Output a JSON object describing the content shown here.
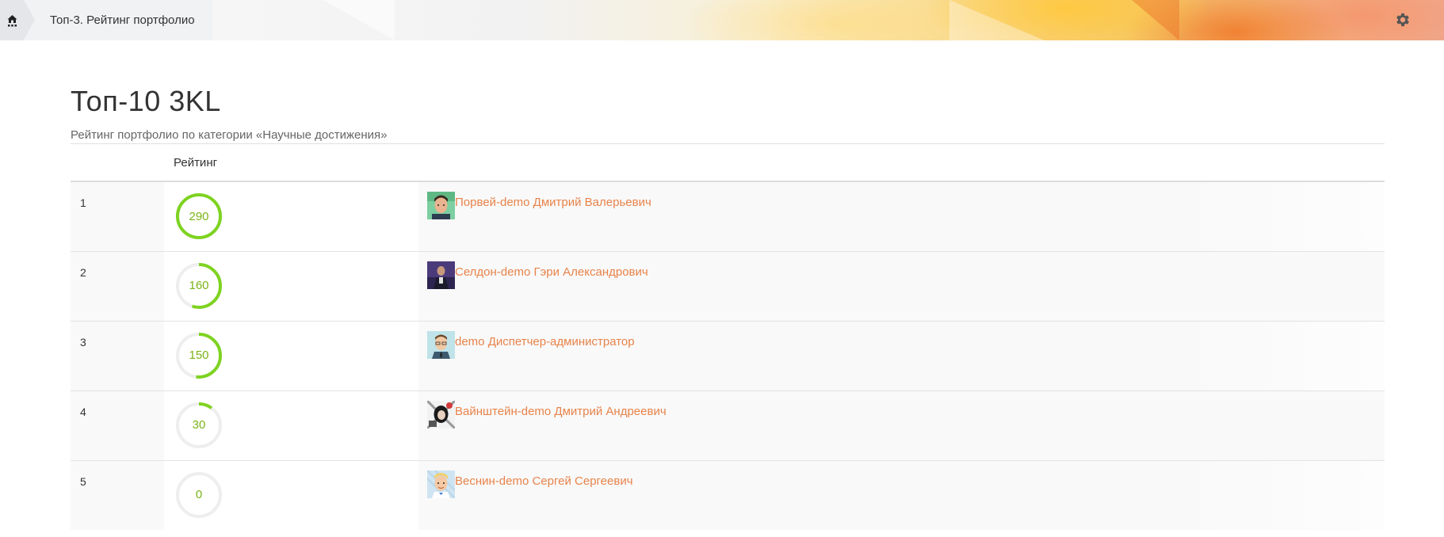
{
  "breadcrumb": {
    "current": "Топ-3. Рейтинг портфолио"
  },
  "page": {
    "title": "Топ-10 3KL",
    "subtitle": "Рейтинг портфолио по категории «Научные достижения»"
  },
  "table": {
    "headers": [
      "",
      "Рейтинг",
      ""
    ],
    "rows": [
      {
        "rank": "1",
        "score": "290",
        "score_fraction": 1.0,
        "name": "Порвей-demo Дмитрий Валерьевич",
        "avatar": "avatar-man-green"
      },
      {
        "rank": "2",
        "score": "160",
        "score_fraction": 0.55,
        "name": "Селдон-demo Гэри Александрович",
        "avatar": "avatar-man-purple"
      },
      {
        "rank": "3",
        "score": "150",
        "score_fraction": 0.52,
        "name": "demo Диспетчер-администратор",
        "avatar": "avatar-man-tie"
      },
      {
        "rank": "4",
        "score": "30",
        "score_fraction": 0.1,
        "name": "Вайнштейн-demo Дмитрий Андреевич",
        "avatar": "avatar-woman-dark"
      },
      {
        "rank": "5",
        "score": "0",
        "score_fraction": 0.0,
        "name": "Веснин-demo Сергей Сергеевич",
        "avatar": "avatar-blond-man"
      }
    ]
  },
  "colors": {
    "ring_fill": "#7ed321",
    "ring_track": "#eeeeee",
    "link": "#e8834a"
  },
  "icons": {
    "home": "home-icon",
    "settings": "gear-icon"
  }
}
